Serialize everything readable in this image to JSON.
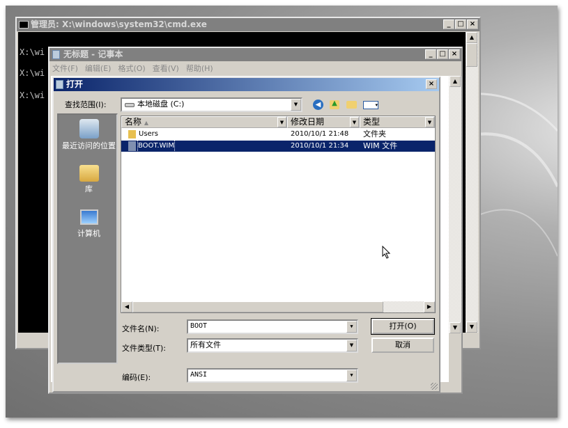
{
  "cmd": {
    "title": "管理员: X:\\windows\\system32\\cmd.exe",
    "lines": [
      "X:\\wi",
      "X:\\wi",
      "X:\\wi"
    ]
  },
  "notepad": {
    "title": "无标题 - 记事本",
    "menu": [
      "文件(F)",
      "编辑(E)",
      "格式(O)",
      "查看(V)",
      "帮助(H)"
    ]
  },
  "dialog": {
    "title": "打开",
    "look_in_label": "查找范围(I):",
    "look_in_value": "本地磁盘 (C:)",
    "places": [
      {
        "label": "最近访问的位置",
        "icon": "recent-places-icon"
      },
      {
        "label": "库",
        "icon": "libraries-icon"
      },
      {
        "label": "计算机",
        "icon": "computer-icon"
      }
    ],
    "columns": [
      "名称",
      "修改日期",
      "类型"
    ],
    "files": [
      {
        "name": "Users",
        "date": "2010/10/1 21:48",
        "type": "文件夹",
        "icon": "folder-icon",
        "selected": false
      },
      {
        "name": "BOOT.WIM",
        "date": "2010/10/1 21:34",
        "type": "WIM 文件",
        "icon": "file-icon",
        "selected": true
      }
    ],
    "filename_label": "文件名(N):",
    "filename_value": "BOOT",
    "filetype_label": "文件类型(T):",
    "filetype_value": "所有文件",
    "encoding_label": "编码(E):",
    "encoding_value": "ANSI",
    "open_label": "打开(O)",
    "cancel_label": "取消"
  },
  "colors": {
    "selection": "#0a246a",
    "title_active_start": "#0a246a",
    "title_active_end": "#a6caf0"
  }
}
